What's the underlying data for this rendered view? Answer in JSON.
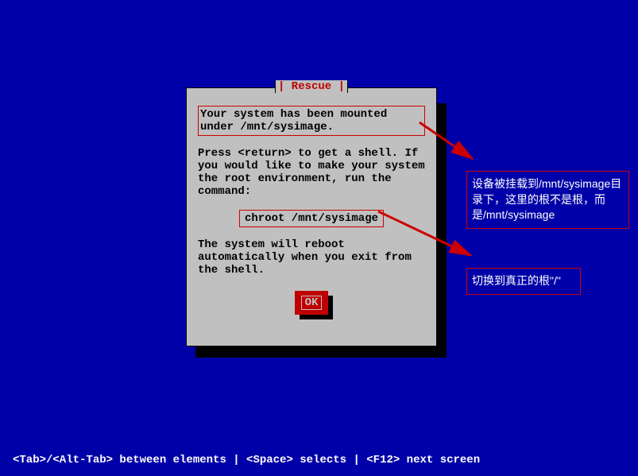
{
  "dialog": {
    "title": "Rescue",
    "mounted_text": "Your system has been mounted under /mnt/sysimage.",
    "instructions": "Press <return> to get a shell. If you would like to make your system the root environment, run the command:",
    "command": "chroot /mnt/sysimage",
    "reboot_text": "The system will reboot automatically when you exit from the shell.",
    "ok_label": "OK"
  },
  "annotations": {
    "mount_note": "设备被挂载到/mnt/sysimage目录下，这里的根不是根，而是/mnt/sysimage",
    "chroot_note": "切换到真正的根\"/\""
  },
  "statusbar": {
    "text": "<Tab>/<Alt-Tab> between elements   |   <Space> selects   |   <F12> next screen"
  }
}
